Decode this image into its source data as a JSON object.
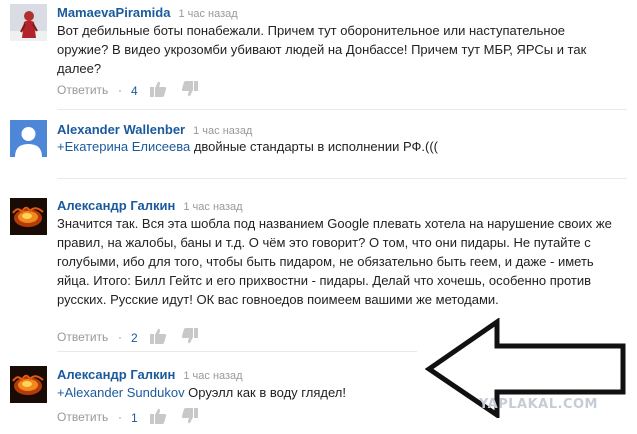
{
  "comments": [
    {
      "author": "MamaevaPiramida",
      "time": "1 час назад",
      "text": "Вот дебильные боты понабежали. Причем тут оборонительное или наступательное оружие? В видео укрозомби убивают людей на Донбассе! Причем тут МБР, ЯРСы и так далее?",
      "reply_label": "Ответить",
      "dot": "·",
      "likes": "4"
    },
    {
      "author": "Alexander Wallenber",
      "time": "1 час назад",
      "mention": "+Екатерина Елисеева",
      "text": " двойные стандарты в исполнении РФ.((("
    },
    {
      "author": "Александр Галкин",
      "time": "1 час назад",
      "text": "Значится так. Вся эта шобла под названием Google плевать хотела на нарушение своих же правил, на жалобы, баны и т.д. О чём это говорит? О том, что они пидары. Не путайте с голубыми, ибо для того, чтобы быть пидаром, не обязательно быть геем, и даже - иметь яйца. Итого: Билл Гейтс  и его прихвостни - пидары. Делай что хочешь, особенно против русских. Русские идут!  ОК вас говноедов поимеем вашими же методами.",
      "reply_label": "Ответить",
      "dot": "·",
      "likes": "2"
    },
    {
      "author": "Александр Галкин",
      "time": "1 час назад",
      "mention": "+Alexander Sundukov",
      "text": " Оруэлл как в воду глядел!",
      "reply_label": "Ответить",
      "dot": "·",
      "likes": "1"
    }
  ],
  "watermark": "YAPLAKAL.COM",
  "icons": {
    "like": "thumbs-up-icon",
    "dislike": "thumbs-down-icon",
    "arrow": "left-arrow-annotation"
  },
  "colors": {
    "author": "#1a5a9c",
    "meta": "#999999",
    "icon": "#c8c8c8"
  }
}
